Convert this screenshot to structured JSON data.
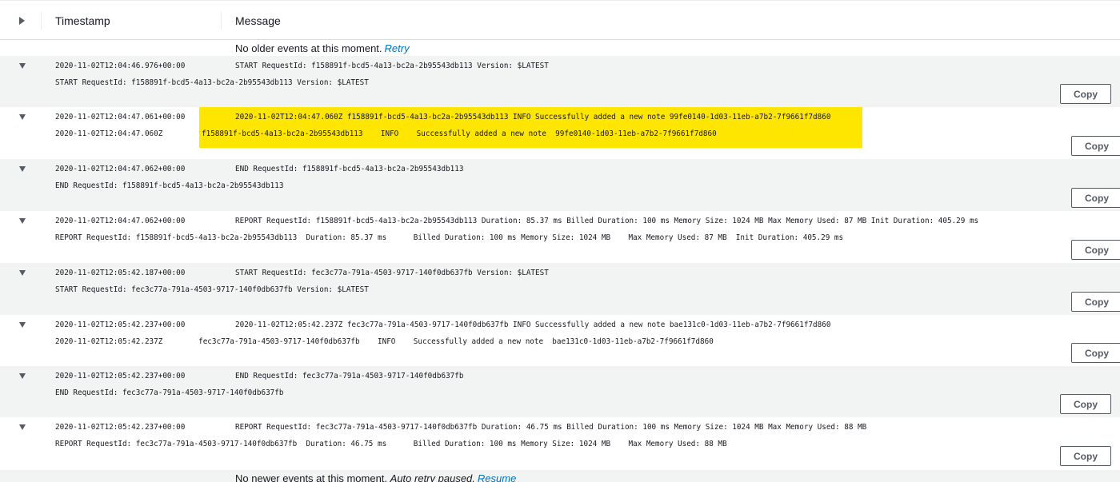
{
  "header": {
    "timestamp_label": "Timestamp",
    "message_label": "Message"
  },
  "older_notice": {
    "text": "No older events at this moment.",
    "retry_label": "Retry"
  },
  "newer_notice": {
    "text": "No newer events at this moment.",
    "auto_retry_label": "Auto retry paused.",
    "resume_label": "Resume"
  },
  "copy_label": "Copy",
  "highlight_color": "#ffe600",
  "events": [
    {
      "timestamp": "2020-11-02T12:04:46.976+00:00",
      "message": "START RequestId: f158891f-bcd5-4a13-bc2a-2b95543db113 Version: $LATEST",
      "detail": "START RequestId: f158891f-bcd5-4a13-bc2a-2b95543db113 Version: $LATEST"
    },
    {
      "timestamp": "2020-11-02T12:04:47.061+00:00",
      "message": "2020-11-02T12:04:47.060Z f158891f-bcd5-4a13-bc2a-2b95543db113 INFO Successfully added a new note 99fe0140-1d03-11eb-a7b2-7f9661f7d860",
      "detail_time": "2020-11-02T12:04:47.060Z",
      "detail": "f158891f-bcd5-4a13-bc2a-2b95543db113    INFO    Successfully added a new note  99fe0140-1d03-11eb-a7b2-7f9661f7d860"
    },
    {
      "timestamp": "2020-11-02T12:04:47.062+00:00",
      "message": "END RequestId: f158891f-bcd5-4a13-bc2a-2b95543db113",
      "detail": "END RequestId: f158891f-bcd5-4a13-bc2a-2b95543db113"
    },
    {
      "timestamp": "2020-11-02T12:04:47.062+00:00",
      "message": "REPORT RequestId: f158891f-bcd5-4a13-bc2a-2b95543db113 Duration: 85.37 ms Billed Duration: 100 ms Memory Size: 1024 MB Max Memory Used: 87 MB Init Duration: 405.29 ms",
      "detail": "REPORT RequestId: f158891f-bcd5-4a13-bc2a-2b95543db113  Duration: 85.37 ms      Billed Duration: 100 ms Memory Size: 1024 MB    Max Memory Used: 87 MB  Init Duration: 405.29 ms"
    },
    {
      "timestamp": "2020-11-02T12:05:42.187+00:00",
      "message": "START RequestId: fec3c77a-791a-4503-9717-140f0db637fb Version: $LATEST",
      "detail": "START RequestId: fec3c77a-791a-4503-9717-140f0db637fb Version: $LATEST"
    },
    {
      "timestamp": "2020-11-02T12:05:42.237+00:00",
      "message": "2020-11-02T12:05:42.237Z fec3c77a-791a-4503-9717-140f0db637fb INFO Successfully added a new note bae131c0-1d03-11eb-a7b2-7f9661f7d860",
      "detail": "2020-11-02T12:05:42.237Z        fec3c77a-791a-4503-9717-140f0db637fb    INFO    Successfully added a new note  bae131c0-1d03-11eb-a7b2-7f9661f7d860"
    },
    {
      "timestamp": "2020-11-02T12:05:42.237+00:00",
      "message": "END RequestId: fec3c77a-791a-4503-9717-140f0db637fb",
      "detail": "END RequestId: fec3c77a-791a-4503-9717-140f0db637fb"
    },
    {
      "timestamp": "2020-11-02T12:05:42.237+00:00",
      "message": "REPORT RequestId: fec3c77a-791a-4503-9717-140f0db637fb Duration: 46.75 ms Billed Duration: 100 ms Memory Size: 1024 MB Max Memory Used: 88 MB",
      "detail": "REPORT RequestId: fec3c77a-791a-4503-9717-140f0db637fb  Duration: 46.75 ms      Billed Duration: 100 ms Memory Size: 1024 MB    Max Memory Used: 88 MB"
    }
  ]
}
